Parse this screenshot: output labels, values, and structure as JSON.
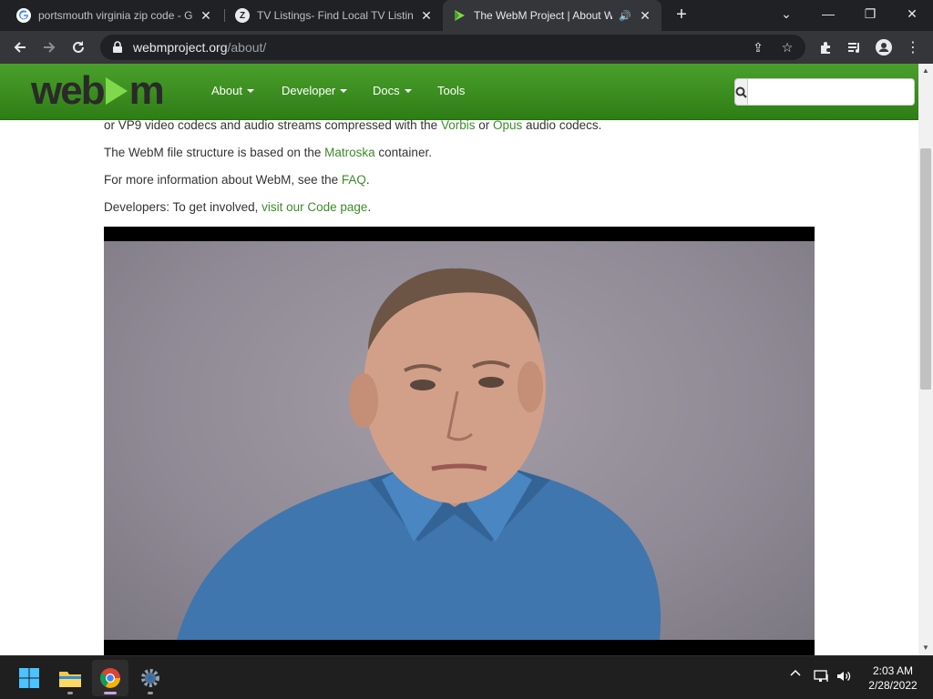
{
  "browser": {
    "tabs": [
      {
        "title": "portsmouth virginia zip code - G",
        "favicon": "google-icon",
        "active": false
      },
      {
        "title": "TV Listings- Find Local TV Listing",
        "favicon": "z-icon",
        "active": false
      },
      {
        "title": "The WebM Project | About W",
        "favicon": "webm-icon",
        "active": true,
        "audio": true
      }
    ],
    "new_tab": "+",
    "window_controls": {
      "tab_search": "⌄",
      "minimize": "—",
      "restore": "❐",
      "close": "✕"
    },
    "url": {
      "host": "webmproject.org",
      "path": "/about/"
    }
  },
  "site": {
    "logo": {
      "left": "web",
      "right": "m"
    },
    "nav": [
      {
        "label": "About",
        "dropdown": true
      },
      {
        "label": "Developer",
        "dropdown": true
      },
      {
        "label": "Docs",
        "dropdown": true
      },
      {
        "label": "Tools",
        "dropdown": false
      }
    ],
    "search": {
      "placeholder": "",
      "value": ""
    },
    "colors": {
      "header_green": "#3a8f22",
      "link_green": "#3d8b2a",
      "logo_play": "#7fd94a"
    }
  },
  "content": {
    "p1": {
      "before": "or VP9 video codecs and audio streams compressed with the ",
      "link1": "Vorbis",
      "middle": " or ",
      "link2": "Opus",
      "after": " audio codecs."
    },
    "p2": {
      "before": "The WebM file structure is based on the ",
      "link": "Matroska",
      "after": " container."
    },
    "p3": {
      "before": "For more information about WebM, see the ",
      "link": "FAQ",
      "after": "."
    },
    "p4": {
      "before": "Developers: To get involved, ",
      "link": "visit our Code page",
      "after": "."
    }
  },
  "taskbar": {
    "apps": [
      "windows-start-icon",
      "file-explorer-icon",
      "chrome-icon",
      "settings-icon"
    ],
    "clock": {
      "time": "2:03 AM",
      "date": "2/28/2022"
    }
  }
}
